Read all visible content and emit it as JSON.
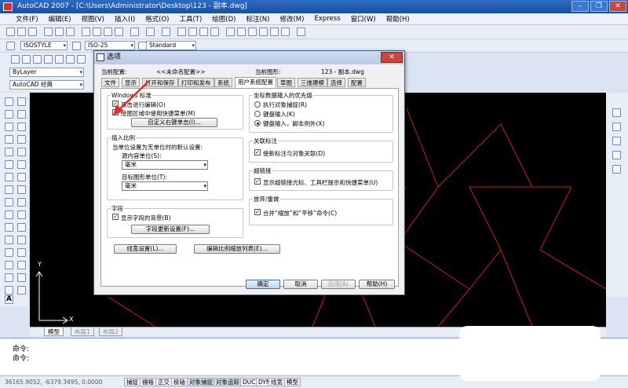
{
  "window": {
    "title": "AutoCAD 2007 - [C:\\Users\\Administrator\\Desktop\\123 - 副本.dwg]"
  },
  "menubar": [
    "文件(F)",
    "编辑(E)",
    "视图(V)",
    "插入(I)",
    "格式(O)",
    "工具(T)",
    "绘图(D)",
    "标注(N)",
    "修改(M)",
    "Express",
    "窗口(W)",
    "帮助(H)"
  ],
  "toolbar": {
    "text_style": "ISOSTYLE",
    "dim_style": "ISO-25",
    "table_style": "Standard",
    "layer": "ByLayer",
    "workspace": "AutoCAD 经典"
  },
  "layout_tabs": [
    "模型",
    "布局1",
    "布局2"
  ],
  "command": {
    "line1": "命令:",
    "line2": "命令:"
  },
  "status": {
    "coords": "36165.9052, -6379.3495, 0.0000",
    "buttons": [
      "捕捉",
      "栅格",
      "正交",
      "极轴",
      "对象捕捉",
      "对象追踪",
      "DUCS",
      "DYN",
      "线宽",
      "模型"
    ]
  },
  "dialog": {
    "title": "选项",
    "current_profile_label": "当前配置:",
    "current_profile": "<<未命名配置>>",
    "current_drawing_label": "当前图形:",
    "current_drawing": "123 - 副本.dwg",
    "tabs": [
      "文件",
      "显示",
      "打开和保存",
      "打印和发布",
      "系统",
      "用户系统配置",
      "草图",
      "三维建模",
      "选择",
      "配置"
    ],
    "windows_std": {
      "title": "Windows 标准",
      "dbl_click": "双击进行编辑(O)",
      "shortcut": "绘图区域中使用快捷菜单(M)",
      "custom_btn": "自定义右键单击(I)..."
    },
    "insert_scale": {
      "title": "插入比例",
      "desc": "当单位设置为无单位时的默认设置:",
      "source_label": "源内容单位(S):",
      "source_val": "毫米",
      "target_label": "目标图形单位(T):",
      "target_val": "毫米"
    },
    "fields": {
      "title": "字段",
      "show_bg": "显示字段的背景(B)",
      "update_btn": "字段更新设置(F)..."
    },
    "coord_priority": {
      "title": "坐标数据输入的优先级",
      "opt1": "执行对象捕捉(R)",
      "opt2": "键盘输入(K)",
      "opt3": "键盘输入，脚本例外(X)"
    },
    "assoc_dim": {
      "title": "关联标注",
      "new_assoc": "使新标注与对象关联(D)"
    },
    "hyperlink": {
      "title": "超链接",
      "show": "显示超链接光标、工具栏提示和快捷菜单(U)"
    },
    "undo": {
      "title": "放弃/重做",
      "merge": "合并“缩放”和“平移”命令(C)"
    },
    "lineweight_btn": "线宽设置(L)...",
    "scale_list_btn": "编辑比例缩放列表(E)...",
    "ok": "确定",
    "cancel": "取消",
    "apply": "应用(A)",
    "help": "帮助(H)"
  },
  "colors": {
    "canvas": "#000000",
    "lines": "#c81e1e",
    "arrow": "#e0302a",
    "accent": "#1b4f9e"
  }
}
